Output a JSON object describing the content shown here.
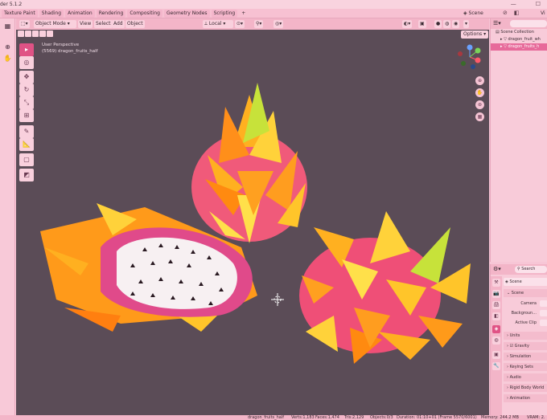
{
  "app": {
    "title": "der 5.1.2"
  },
  "workspace_tabs": [
    "Texture Paint",
    "Shading",
    "Animation",
    "Rendering",
    "Compositing",
    "Geometry Nodes",
    "Scripting",
    "+"
  ],
  "scene_selector": "Scene",
  "view_layer": "Vi",
  "viewport": {
    "mode": "Object Mode",
    "menus": [
      "View",
      "Select",
      "Add",
      "Object"
    ],
    "transform_orientation": "Local",
    "options_label": "Options",
    "view_name": "User Perspective",
    "object_info": "(5569) dragon_fruits_half"
  },
  "outliner": {
    "rows": [
      {
        "label": "Scene Collection",
        "selected": false
      },
      {
        "label": "dragon_fruit_wh",
        "selected": false
      },
      {
        "label": "dragon_fruits_h",
        "selected": true
      }
    ]
  },
  "properties": {
    "search_placeholder": "Search",
    "scene_label": "Scene",
    "section_scene": "Scene",
    "camera_label": "Camera",
    "background_label": "Backgroun...",
    "active_clip_label": "Active Clip",
    "panels": [
      "Units",
      "Gravity",
      "Simulation",
      "Keying Sets",
      "Audio",
      "Rigid Body World",
      "Animation"
    ]
  },
  "status": {
    "object": "dragon_fruits_half",
    "verts": "Verts:1,183",
    "faces": "Faces:1,474",
    "tris": "Tris:2,129",
    "objects": "Objects:0/3",
    "duration": "Duration: 01:10+01 (Frame 5570/6001)",
    "memory": "Memory: 244.2 MB",
    "vram": "VRAM: 2."
  },
  "colors": {
    "accent": "#e05285",
    "viewport_bg": "#5b4c57",
    "ui_pink": "#f7c6d6"
  }
}
